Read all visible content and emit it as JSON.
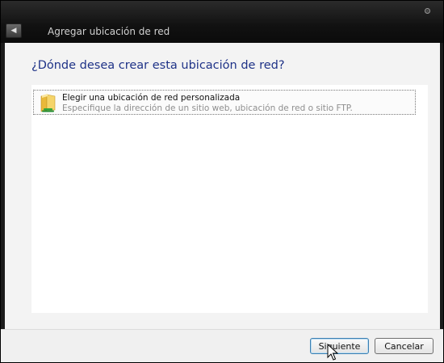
{
  "window": {
    "title": "Agregar ubicación de red",
    "back_icon": "back-arrow-icon",
    "close_icon": "close-icon"
  },
  "main": {
    "heading": "¿Dónde desea crear esta ubicación de red?",
    "options": [
      {
        "icon": "folder-network-icon",
        "title": "Elegir una ubicación de red personalizada",
        "description": "Especifique la dirección de un sitio web, ubicación de red o sitio FTP."
      }
    ]
  },
  "footer": {
    "next_label": "Siguiente",
    "cancel_label": "Cancelar"
  },
  "colors": {
    "heading": "#1e3287",
    "titlebar": "#111111"
  }
}
